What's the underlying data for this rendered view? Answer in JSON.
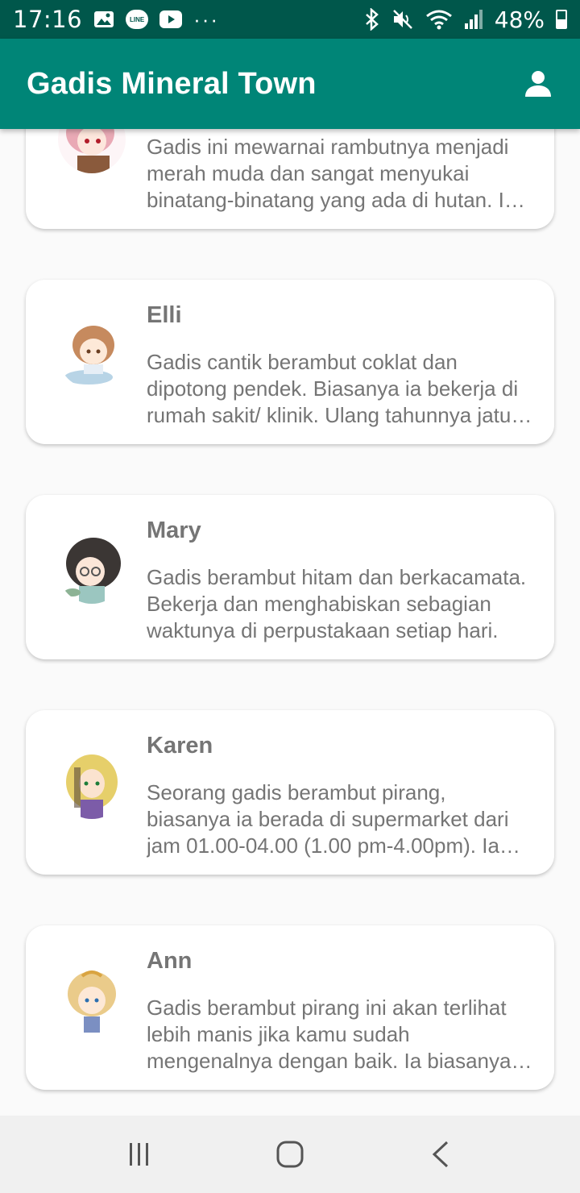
{
  "status_bar": {
    "time": "17:16",
    "more": "···",
    "battery": "48%",
    "notification_icons": [
      "image-icon",
      "line-icon",
      "youtube-icon"
    ],
    "system_icons": [
      "bluetooth-icon",
      "mute-icon",
      "wifi-icon",
      "signal-icon",
      "battery-icon"
    ],
    "line_text": "LINE"
  },
  "app_bar": {
    "title": "Gadis Mineral Town",
    "action_icon": "account-icon"
  },
  "characters": [
    {
      "name": "",
      "description": "Gadis ini mewarnai rambutnya menjadi merah muda dan sangat menyukai binatang-binatang yang ada di hutan. Ia juga senang sekali bertemu dengan kamu."
    },
    {
      "name": "Elli",
      "description": "Gadis cantik berambut coklat dan dipotong pendek. Biasanya ia bekerja di rumah sakit/ klinik. Ulang tahunnya jatuh pada musim semi."
    },
    {
      "name": "Mary",
      "description": "Gadis berambut hitam dan berkacamata. Bekerja dan menghabiskan sebagian waktunya di perpustakaan setiap hari."
    },
    {
      "name": "Karen",
      "description": "Seorang gadis berambut pirang, biasanya ia berada di supermarket dari jam 01.00-04.00 (1.00 pm-4.00pm). Ia suka minuman anggur."
    },
    {
      "name": "Ann",
      "description": "Gadis berambut pirang ini akan terlihat lebih manis jika kamu sudah mengenalnya dengan baik. Ia biasanya berada di penginapan."
    }
  ],
  "colors": {
    "status_bar": "#00574b",
    "app_bar": "#008577",
    "background": "#fafafa",
    "card": "#ffffff",
    "text": "#757575"
  },
  "nav_bar": {
    "buttons": [
      "recent-apps-icon",
      "home-icon",
      "back-icon"
    ]
  }
}
